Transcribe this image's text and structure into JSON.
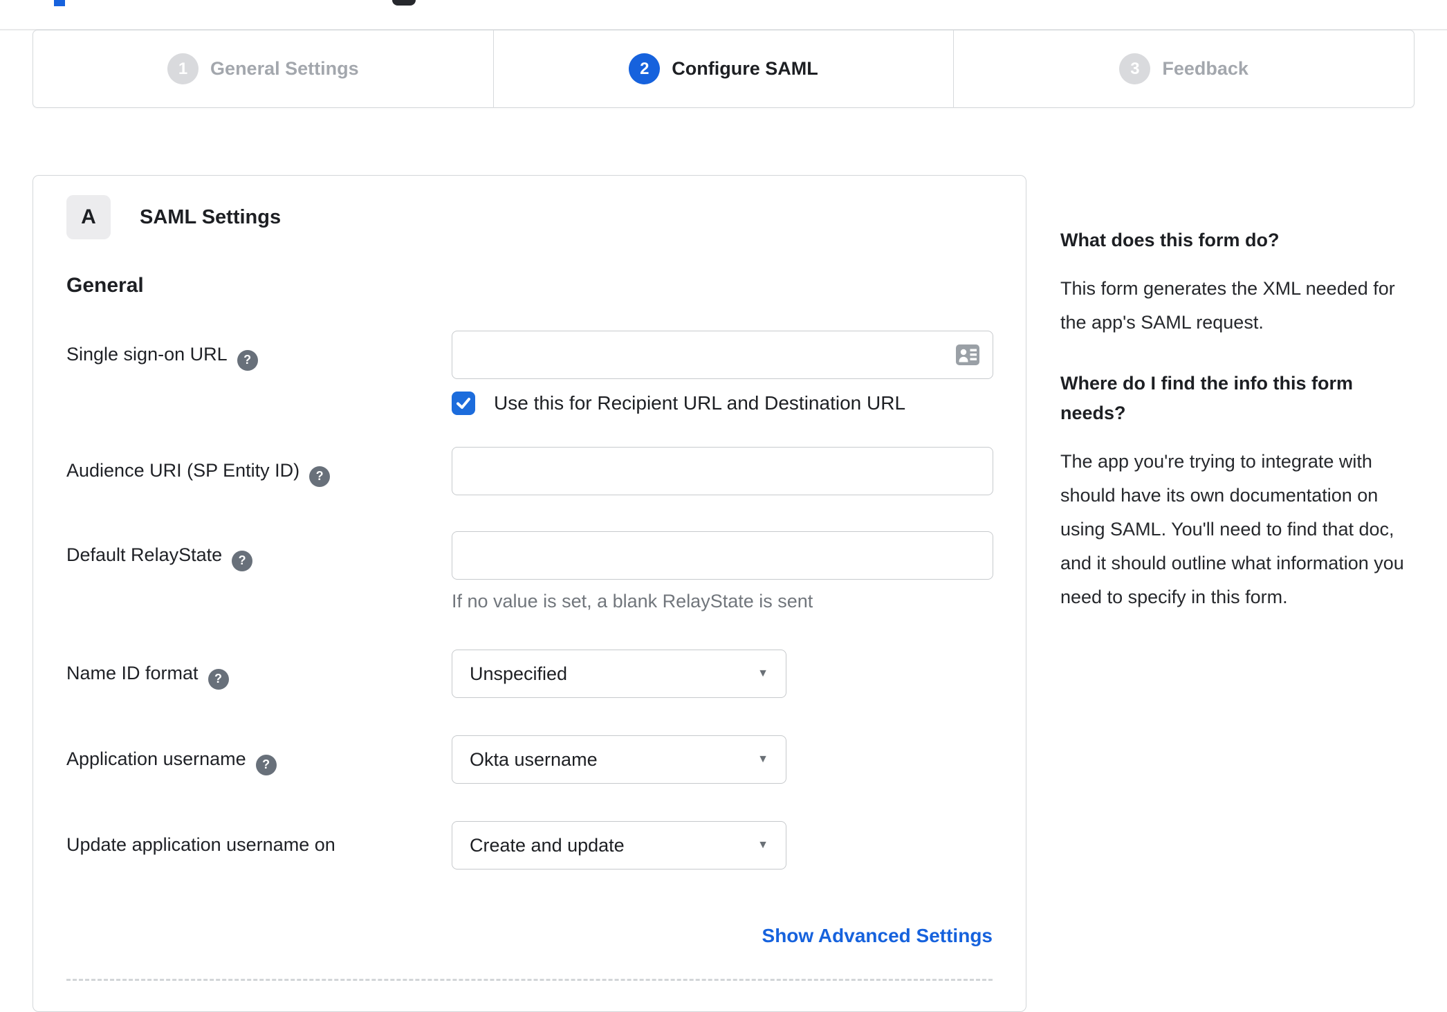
{
  "colors": {
    "accent_blue": "#1662dd",
    "checkbox_blue": "#1c6cdc",
    "inactive_step_gray": "#d9dadd",
    "inactive_label_gray": "#a3a7ad",
    "border_gray": "#d3d6d9",
    "hint_gray": "#71767c"
  },
  "stepper": {
    "steps": [
      {
        "number": "1",
        "label": "General Settings",
        "state": "inactive"
      },
      {
        "number": "2",
        "label": "Configure SAML",
        "state": "active"
      },
      {
        "number": "3",
        "label": "Feedback",
        "state": "inactive"
      }
    ]
  },
  "panel": {
    "badge": "A",
    "title": "SAML Settings",
    "section": "General",
    "fields": [
      {
        "label": "Single sign-on URL",
        "has_help": true,
        "value": "",
        "checkbox": {
          "checked": true,
          "label": "Use this for Recipient URL and Destination URL"
        }
      },
      {
        "label": "Audience URI (SP Entity ID)",
        "has_help": true,
        "value": ""
      },
      {
        "label": "Default RelayState",
        "has_help": true,
        "value": "",
        "hint": "If no value is set, a blank RelayState is sent"
      },
      {
        "label": "Name ID format",
        "has_help": true,
        "selected": "Unspecified"
      },
      {
        "label": "Application username",
        "has_help": true,
        "selected": "Okta username"
      },
      {
        "label": "Update application username on",
        "has_help": false,
        "selected": "Create and update"
      }
    ],
    "help_glyph": "?",
    "advanced_link": "Show Advanced Settings"
  },
  "help_sidebar": {
    "heading1": "What does this form do?",
    "para1": "This form generates the XML needed for the app's SAML request.",
    "heading2": "Where do I find the info this form needs?",
    "para2": "The app you're trying to integrate with should have its own documentation on using SAML. You'll need to find that doc, and it should outline what information you need to specify in this form."
  }
}
